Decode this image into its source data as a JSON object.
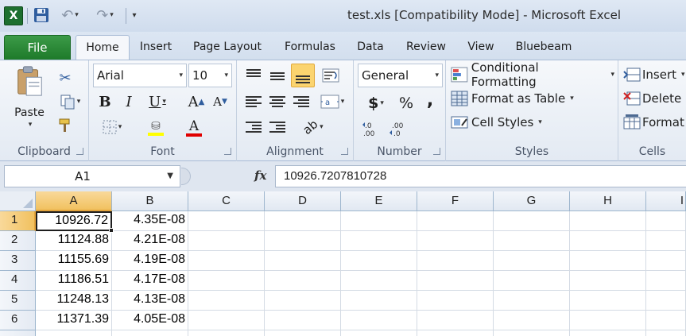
{
  "window": {
    "title": "test.xls  [Compatibility Mode]  -  Microsoft Excel",
    "app_icon": "excel-icon"
  },
  "tabs": [
    "File",
    "Home",
    "Insert",
    "Page Layout",
    "Formulas",
    "Data",
    "Review",
    "View",
    "Bluebeam"
  ],
  "active_tab": "Home",
  "ribbon": {
    "clipboard": {
      "label": "Clipboard",
      "paste_label": "Paste"
    },
    "font": {
      "label": "Font",
      "font_name": "Arial",
      "font_size": "10"
    },
    "alignment": {
      "label": "Alignment"
    },
    "number": {
      "label": "Number",
      "format": "General",
      "currency": "$",
      "percent": "%",
      "comma": ","
    },
    "styles": {
      "label": "Styles",
      "conditional_formatting": "Conditional Formatting",
      "format_as_table": "Format as Table",
      "cell_styles": "Cell Styles"
    },
    "cells": {
      "label": "Cells",
      "insert": "Insert",
      "delete": "Delete",
      "format": "Format"
    }
  },
  "formula_bar": {
    "name_box": "A1",
    "fx": "fx",
    "formula": "10926.7207810728"
  },
  "sheet": {
    "columns": [
      "A",
      "B",
      "C",
      "D",
      "E",
      "F",
      "G",
      "H",
      "I"
    ],
    "rows": [
      {
        "num": "1",
        "a": "10926.72",
        "b": "4.35E-08"
      },
      {
        "num": "2",
        "a": "11124.88",
        "b": "4.21E-08"
      },
      {
        "num": "3",
        "a": "11155.69",
        "b": "4.19E-08"
      },
      {
        "num": "4",
        "a": "11186.51",
        "b": "4.17E-08"
      },
      {
        "num": "5",
        "a": "11248.13",
        "b": "4.13E-08"
      },
      {
        "num": "6",
        "a": "11371.39",
        "b": "4.05E-08"
      }
    ],
    "selected_cell": "A1"
  },
  "colors": {
    "file_tab": "#1e7a2a",
    "selection_header": "#f1c15f",
    "highlight_color": "#ffff00",
    "font_color": "#e00000"
  }
}
